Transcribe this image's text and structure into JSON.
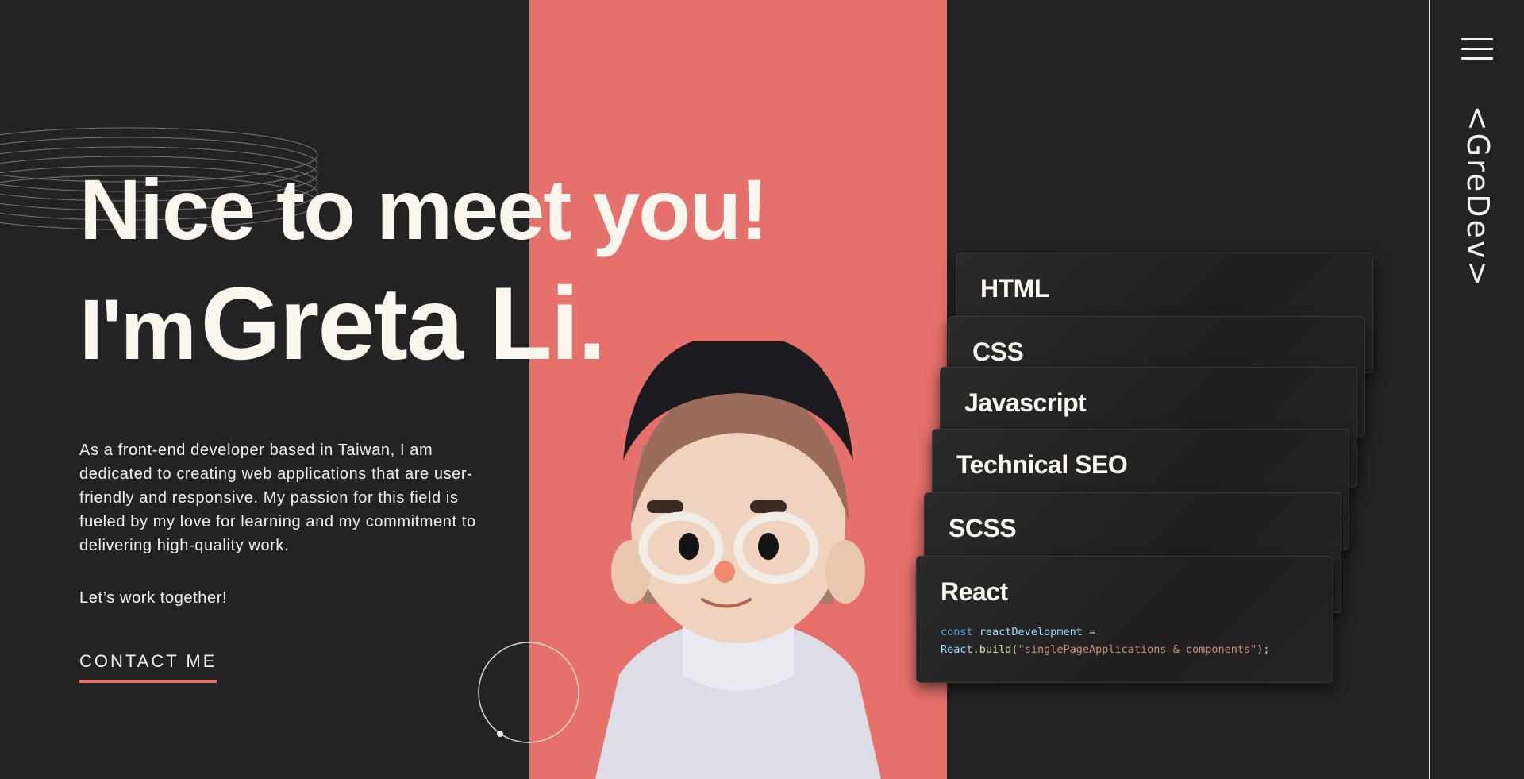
{
  "hero": {
    "line1": "Nice to meet you!",
    "line2_prefix": "I'm",
    "line2_name": "Greta Li."
  },
  "bio": "As a front-end developer based in Taiwan, I am dedicated to creating web applications that are user-friendly and responsive. My passion for this field is fueled by my love for learning and my commitment to delivering high-quality work.",
  "cta_text": "Let’s work together!",
  "contact_label": "CONTACT ME",
  "skills": [
    {
      "title": "HTML"
    },
    {
      "title": "CSS"
    },
    {
      "title": "Javascript"
    },
    {
      "title": "Technical SEO"
    },
    {
      "title": "SCSS"
    },
    {
      "title": "React"
    }
  ],
  "react_code": {
    "keyword": "const",
    "variable": "reactDevelopment",
    "operator": " =",
    "object": "React",
    "dot": ".",
    "method": "build",
    "open": "(",
    "string": "\"singlePageApplications & components\"",
    "close": ");"
  },
  "sidebar": {
    "logo": "<GreDev>",
    "menu_icon": "hamburger-menu-icon"
  },
  "colors": {
    "background": "#232323",
    "accent": "#e6716a",
    "text": "#fbf7ee"
  }
}
